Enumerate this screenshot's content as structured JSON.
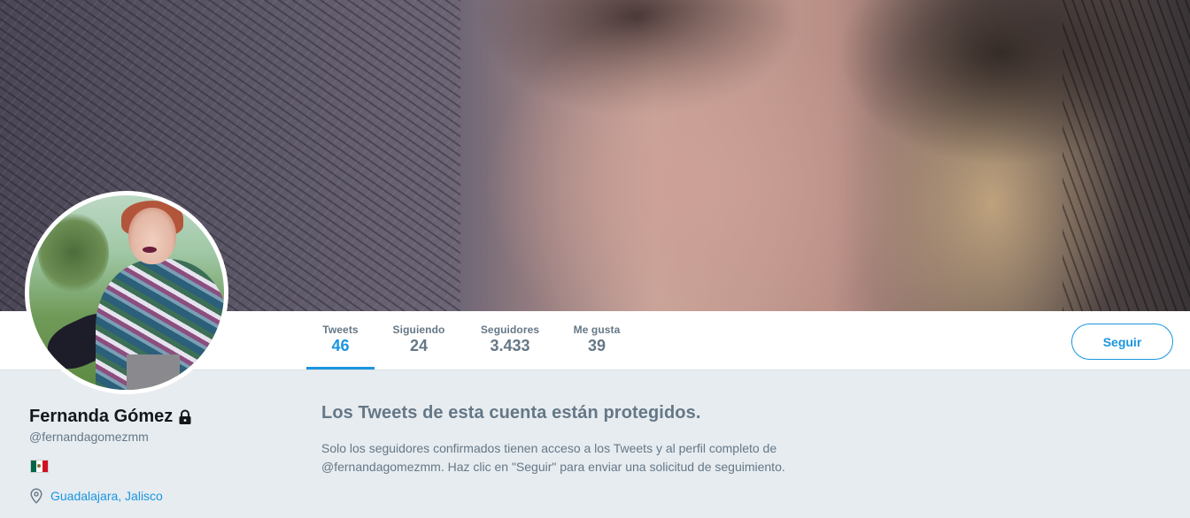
{
  "profile": {
    "name": "Fernanda Gómez",
    "handle": "@fernandagomezmm",
    "location": "Guadalajara, Jalisco",
    "flag": "mexico-flag-icon",
    "protected_icon": "lock-icon"
  },
  "stats": [
    {
      "label": "Tweets",
      "value": "46",
      "active": true
    },
    {
      "label": "Siguiendo",
      "value": "24",
      "active": false
    },
    {
      "label": "Seguidores",
      "value": "3.433",
      "active": false
    },
    {
      "label": "Me gusta",
      "value": "39",
      "active": false
    }
  ],
  "follow_button": {
    "label": "Seguir"
  },
  "protected": {
    "title": "Los Tweets de esta cuenta están protegidos.",
    "line1": "Solo los seguidores confirmados tienen acceso a los Tweets y al perfil completo de",
    "line2": "@fernandagomezmm. Haz clic en \"Seguir\" para enviar una solicitud de seguimiento."
  },
  "colors": {
    "accent": "#1b95e0",
    "muted_text": "#657786",
    "page_background": "#e6ecf0"
  }
}
